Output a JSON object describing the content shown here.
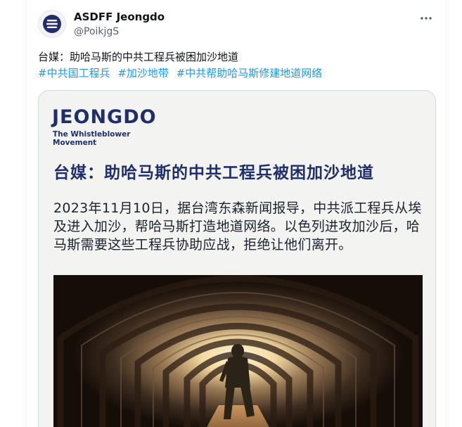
{
  "tweet": {
    "display_name": "ASDFF Jeongdo",
    "handle": "@PoikjgS",
    "text": "台媒：助哈马斯的中共工程兵被困加沙地道",
    "hashtags": [
      "#中共国工程兵",
      "#加沙地带",
      "#中共帮助哈马斯修建地道网络"
    ],
    "more_icon": "more-dots-icon",
    "avatar_icon": "jeongdo-logo-avatar"
  },
  "card": {
    "brand": "JEONGDO",
    "brand_sub": "The Whistleblower Movement",
    "title": "台媒：助哈马斯的中共工程兵被困加沙地道",
    "body": "2023年11月10日，据台湾东森新闻报导，中共派工程兵从埃及进入加沙，帮哈马斯打造地道网络。以色列进攻加沙后，哈马斯需要这些工程兵协助应战，拒绝让他们离开。",
    "image": "tunnel-photo"
  },
  "colors": {
    "hashtag": "#1d9bf0",
    "brand_navy": "#1f2f6e",
    "handle_gray": "#536471"
  }
}
